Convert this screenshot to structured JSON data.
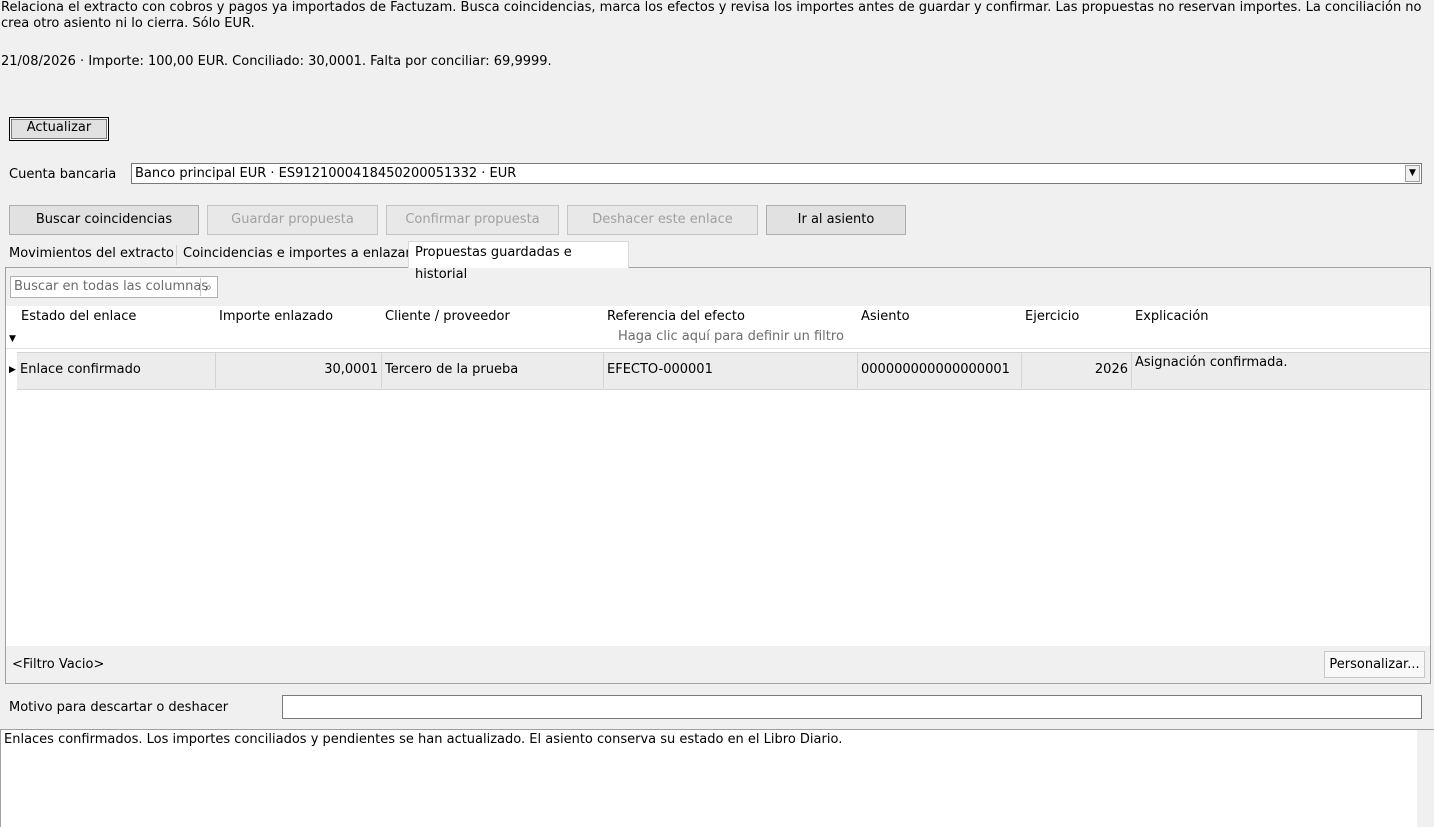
{
  "intro_text": "Relaciona el extracto con cobros y pagos ya importados de Factuzam. Busca coincidencias, marca los efectos y revisa los importes antes de guardar y confirmar. Las propuestas no reservan importes. La conciliación no crea otro asiento ni lo cierra. Sólo EUR.",
  "summary_text": "21/08/2026 · Importe: 100,00 EUR. Conciliado: 30,0001. Falta por conciliar: 69,9999.",
  "buttons": {
    "actualizar": "Actualizar",
    "buscar": "Buscar coincidencias",
    "guardar": "Guardar propuesta",
    "confirmar": "Confirmar propuesta",
    "deshacer": "Deshacer este enlace",
    "ir_asiento": "Ir al asiento",
    "personalizar": "Personalizar..."
  },
  "bank_account": {
    "label": "Cuenta bancaria",
    "selected": "Banco principal EUR  ·  ES9121000418450200051332  ·  EUR"
  },
  "tabs": [
    {
      "label": "Movimientos del extracto"
    },
    {
      "label": "Coincidencias e importes a enlazar"
    },
    {
      "label": "Propuestas guardadas e historial"
    }
  ],
  "grid": {
    "search_placeholder": "Buscar en todas las columnas",
    "columns": [
      "Estado del enlace",
      "Importe enlazado",
      "Cliente / proveedor",
      "Referencia del efecto",
      "Asiento",
      "Ejercicio",
      "Explicación"
    ],
    "filter_hint": "Haga clic aquí para definir un filtro",
    "rows": [
      {
        "estado": "Enlace confirmado",
        "importe": "30,0001",
        "cliente": "Tercero de la prueba",
        "referencia": "EFECTO-000001",
        "asiento": "000000000000000001",
        "ejercicio": "2026",
        "explicacion": "Asignación confirmada."
      }
    ],
    "filter_status": "<Filtro Vacio>"
  },
  "motivo_label": "Motivo para descartar o deshacer",
  "motivo_value": "",
  "status_message": "Enlaces confirmados. Los importes conciliados y pendientes se han actualizado. El asiento conserva su estado en el Libro Diario."
}
